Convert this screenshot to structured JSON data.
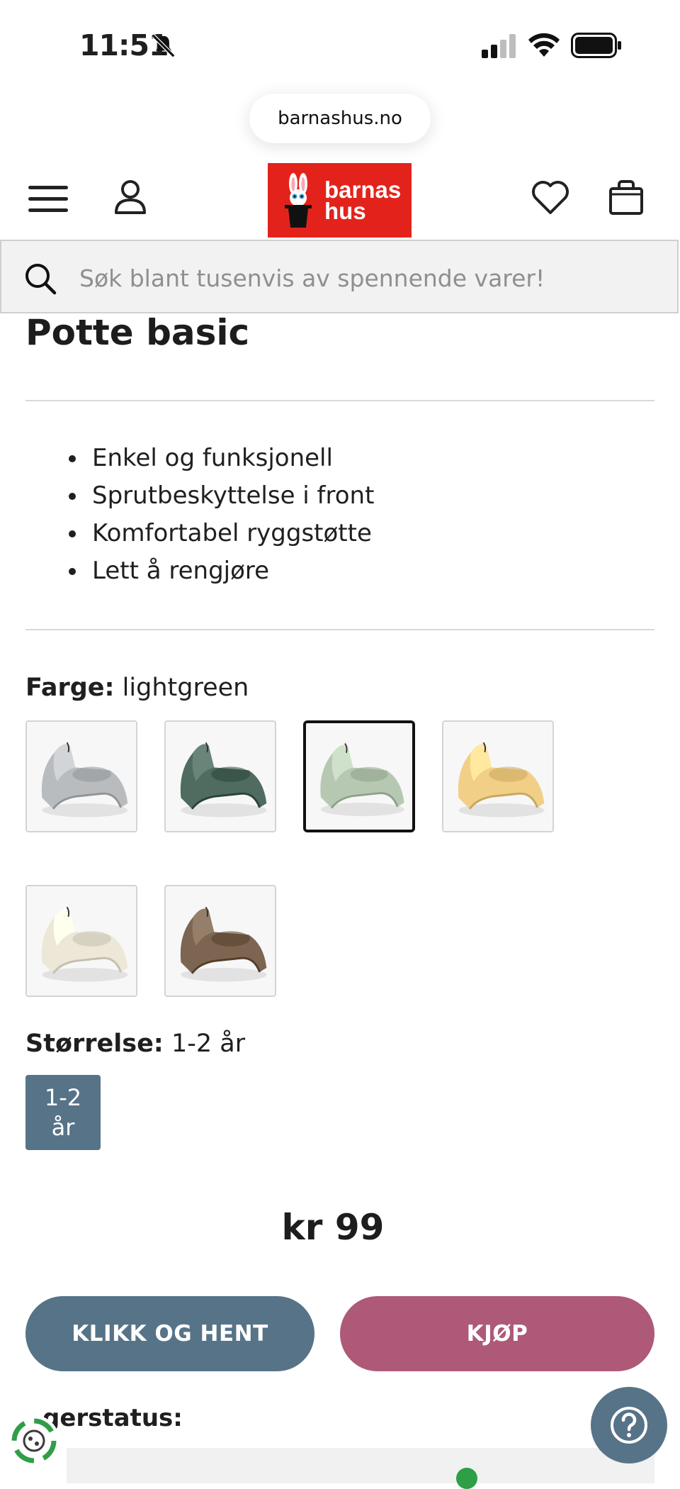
{
  "status_bar": {
    "time": "11:51"
  },
  "browser": {
    "url": "barnashus.no"
  },
  "header": {
    "logo_line1": "barnas",
    "logo_line2": "hus"
  },
  "search": {
    "placeholder": "Søk blant tusenvis av spennende varer!"
  },
  "product": {
    "title": "Potte basic",
    "features": [
      "Enkel og funksjonell",
      "Sprutbeskyttelse i front",
      "Komfortabel ryggstøtte",
      "Lett å rengjøre"
    ],
    "color_label": "Farge:",
    "color_value": "lightgreen",
    "swatches": [
      {
        "color": "#b9bcbf",
        "selected": false
      },
      {
        "color": "#506b60",
        "selected": false
      },
      {
        "color": "#b7c8b2",
        "selected": true
      },
      {
        "color": "#f1cf86",
        "selected": false
      },
      {
        "color": "#ece7d6",
        "selected": false
      },
      {
        "color": "#7c6651",
        "selected": false
      }
    ],
    "size_label": "Størrelse:",
    "size_value": "1-2 år",
    "size_options": [
      {
        "line1": "1-2",
        "line2": "år"
      }
    ],
    "price": "kr 99"
  },
  "actions": {
    "click_collect": "KLIKK OG HENT",
    "buy": "KJØP"
  },
  "stock": {
    "label": "gerstatus:"
  },
  "colors": {
    "brand_red": "#e3231b",
    "primary_blue": "#577388",
    "buy_pink": "#ad5977",
    "stock_green": "#2e9e47"
  },
  "icons": [
    "bell-off-icon",
    "signal-icon",
    "wifi-icon",
    "battery-icon",
    "menu-icon",
    "account-icon",
    "heart-icon",
    "bag-icon",
    "search-icon",
    "help-icon",
    "eco-icon"
  ]
}
